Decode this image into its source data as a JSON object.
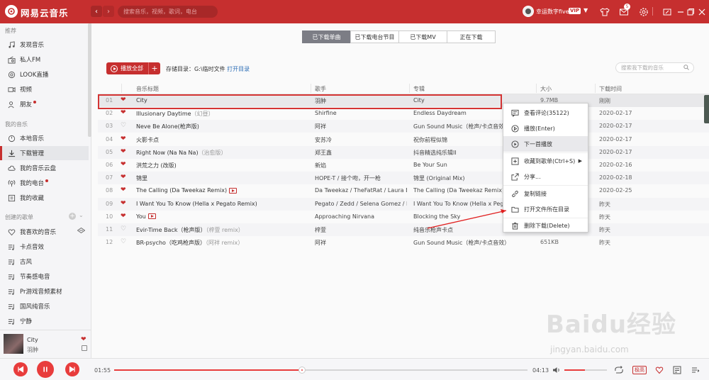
{
  "app": {
    "name": "网易云音乐"
  },
  "topbar": {
    "search_placeholder": "搜索音乐，视频，歌词，电台",
    "username": "幸运数字five",
    "vip": "VIP",
    "msg_count": "5"
  },
  "sidebar": {
    "sections": [
      {
        "title": "推荐",
        "items": [
          {
            "label": "发现音乐",
            "icon": "music-note-icon"
          },
          {
            "label": "私人FM",
            "icon": "radio-icon"
          },
          {
            "label": "LOOK直播",
            "icon": "live-icon"
          },
          {
            "label": "视频",
            "icon": "video-icon"
          },
          {
            "label": "朋友",
            "icon": "friends-icon",
            "dot": true
          }
        ]
      },
      {
        "title": "我的音乐",
        "items": [
          {
            "label": "本地音乐",
            "icon": "local-music-icon"
          },
          {
            "label": "下载管理",
            "icon": "download-icon",
            "active": true
          },
          {
            "label": "我的音乐云盘",
            "icon": "cloud-icon"
          },
          {
            "label": "我的电台",
            "icon": "podcast-icon",
            "dot": true
          },
          {
            "label": "我的收藏",
            "icon": "favorites-icon"
          }
        ]
      },
      {
        "title": "创建的歌单",
        "items": [
          {
            "label": "我喜欢的音乐",
            "icon": "heart-icon"
          },
          {
            "label": "卡点音效",
            "icon": "playlist-icon"
          },
          {
            "label": "古风",
            "icon": "playlist-icon"
          },
          {
            "label": "节奏感电音",
            "icon": "playlist-icon"
          },
          {
            "label": "Pr游戏音频素材",
            "icon": "playlist-icon"
          },
          {
            "label": "国风纯音乐",
            "icon": "playlist-icon"
          },
          {
            "label": "宁静",
            "icon": "playlist-icon"
          }
        ]
      }
    ]
  },
  "now_playing": {
    "title": "City",
    "artist": "羽肿"
  },
  "tabs": [
    {
      "label": "已下载单曲",
      "active": true
    },
    {
      "label": "已下载电台节目",
      "active": false
    },
    {
      "label": "已下载MV",
      "active": false
    },
    {
      "label": "正在下载",
      "active": false
    }
  ],
  "toolbar": {
    "play_all": "播放全部",
    "add": "+",
    "dir_label": "存储目录：G:\\临时文件",
    "open_dir": "打开目录",
    "search_placeholder": "搜索我下载的音乐"
  },
  "table": {
    "headers": [
      "音乐标题",
      "歌手",
      "专辑",
      "大小",
      "下载时间"
    ],
    "rows": [
      {
        "num": "01",
        "liked": true,
        "title": "City",
        "alias": "",
        "mv": false,
        "artist": "羽肿",
        "album": "City",
        "size": "9.7MB",
        "time": "刚刚"
      },
      {
        "num": "02",
        "liked": true,
        "title": "Illusionary Daytime",
        "alias": "（幻昼）",
        "mv": false,
        "artist": "Shirfine",
        "album": "Endless Daydream",
        "size": "",
        "time": "2020-02-17"
      },
      {
        "num": "03",
        "liked": false,
        "title": "Neve Be Alone(枪声版)",
        "alias": "",
        "mv": false,
        "artist": "阿祥",
        "album": "Gun Sound Music（枪声/卡点音效）",
        "size": "",
        "time": "2020-02-17"
      },
      {
        "num": "04",
        "liked": true,
        "title": "火影卡点",
        "alias": "",
        "mv": false,
        "artist": "安苏冷",
        "album": "祝你前程似锦",
        "size": "",
        "time": "2020-02-17"
      },
      {
        "num": "05",
        "liked": true,
        "title": "Right Now (Na Na Na)",
        "alias": "（治愈版）",
        "mv": false,
        "artist": "郑王鑫",
        "album": "抖音精选纯乐辑II",
        "size": "",
        "time": "2020-02-17"
      },
      {
        "num": "06",
        "liked": true,
        "title": "洪荒之力 (改版)",
        "alias": "",
        "mv": false,
        "artist": "新焰",
        "album": "Be Your Sun",
        "size": "",
        "time": "2020-02-16"
      },
      {
        "num": "07",
        "liked": true,
        "title": "锦里",
        "alias": "",
        "mv": false,
        "artist": "HOPE-T / 接个吻，开一枪",
        "album": "锦里 (Original Mix)",
        "size": "",
        "time": "2020-02-18"
      },
      {
        "num": "08",
        "liked": true,
        "title": "The Calling (Da Tweekaz Remix)",
        "alias": "",
        "mv": true,
        "artist": "Da Tweekaz / TheFatRat / Laura Br...",
        "album": "The Calling (Da Tweekaz Remix)",
        "size": "",
        "time": "2020-02-25"
      },
      {
        "num": "09",
        "liked": true,
        "title": "I Want You To Know (Hella x Pegato Remix)",
        "alias": "",
        "mv": false,
        "artist": "Pegato / Zedd / Selena Gomez / Hella",
        "album": "I Want You To Know (Hella x Pegato Remix)",
        "size": "",
        "time": "昨天"
      },
      {
        "num": "10",
        "liked": true,
        "title": "You",
        "alias": "",
        "mv": true,
        "artist": "Approaching Nirvana",
        "album": "Blocking the Sky",
        "size": "",
        "time": "昨天"
      },
      {
        "num": "11",
        "liked": false,
        "title": "Evir-Time Back（枪声版）",
        "alias": "（梓萱 remix）",
        "mv": false,
        "artist": "梓萱",
        "album": "纯音乐枪声卡点",
        "size": "",
        "time": "昨天"
      },
      {
        "num": "12",
        "liked": false,
        "title": "BR-psycho（吃鸡枪声版）",
        "alias": "（阿祥 remix）",
        "mv": false,
        "artist": "阿祥",
        "album": "Gun Sound Music（枪声/卡点音效）",
        "size": "651KB",
        "time": "昨天"
      }
    ]
  },
  "context_menu": {
    "items": [
      {
        "label": "查看评论(35122)",
        "icon": "comment-icon"
      },
      {
        "label": "播放(Enter)",
        "icon": "play-circle-icon"
      },
      {
        "label": "下一首播放",
        "icon": "next-play-icon",
        "highlight": true
      },
      {
        "label": "收藏到歌单(Ctrl+S)",
        "icon": "add-to-playlist-icon",
        "submenu": true
      },
      {
        "label": "分享...",
        "icon": "share-icon"
      },
      {
        "label": "复制链接",
        "icon": "link-icon"
      },
      {
        "label": "打开文件所在目录",
        "icon": "folder-icon"
      },
      {
        "label": "删除下载(Delete)",
        "icon": "trash-icon"
      }
    ]
  },
  "player": {
    "elapsed": "01:55",
    "duration": "04:13",
    "progress": 0.455,
    "volume": 0.48,
    "quality": "极高"
  },
  "watermark": {
    "logo": "Baidu经验",
    "url": "jingyan.baidu.com"
  },
  "colors": {
    "brand": "#c62f2f",
    "accent": "#e83c3c"
  }
}
